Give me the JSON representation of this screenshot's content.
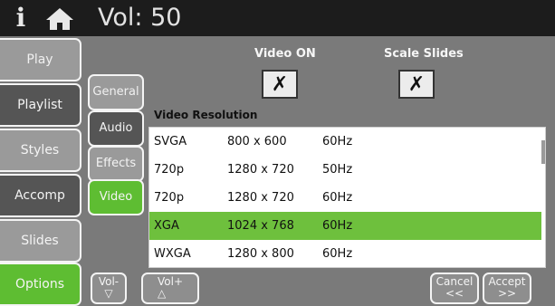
{
  "topbar": {
    "info_label": "i",
    "home_icon": "home-icon",
    "volume": "Vol: 50"
  },
  "sidebar": {
    "items": [
      {
        "label": "Play"
      },
      {
        "label": "Playlist"
      },
      {
        "label": "Styles"
      },
      {
        "label": "Accomp"
      },
      {
        "label": "Slides"
      },
      {
        "label": "Options",
        "selected": true
      }
    ]
  },
  "subtabs": {
    "items": [
      {
        "label": "General"
      },
      {
        "label": "Audio"
      },
      {
        "label": "Effects"
      },
      {
        "label": "Video",
        "selected": true
      }
    ]
  },
  "video_on": {
    "label": "Video ON",
    "checked": true,
    "mark": "✗"
  },
  "scale_slides": {
    "label": "Scale Slides",
    "checked": true,
    "mark": "✗"
  },
  "resolution": {
    "label": "Video Resolution",
    "rows": [
      {
        "name": "SVGA",
        "size": "800 x 600",
        "rate": "60Hz"
      },
      {
        "name": "720p",
        "size": "1280 x 720",
        "rate": "50Hz"
      },
      {
        "name": "720p",
        "size": "1280 x 720",
        "rate": "60Hz"
      },
      {
        "name": "XGA",
        "size": "1024 x 768",
        "rate": "60Hz",
        "selected": true
      },
      {
        "name": "WXGA",
        "size": "1280 x 800",
        "rate": "60Hz"
      }
    ]
  },
  "footer": {
    "vol_minus": "Vol-",
    "vol_minus_icon": "▽",
    "vol_plus": "Vol+",
    "vol_plus_icon": "△",
    "cancel": "Cancel",
    "cancel_icon": "<<",
    "accept": "Accept",
    "accept_icon": ">>"
  },
  "colors": {
    "accent_green": "#5ebd32",
    "panel_gray": "#7a7a7a",
    "topbar": "#1c1c1c",
    "selected_row": "#6ec03d"
  }
}
